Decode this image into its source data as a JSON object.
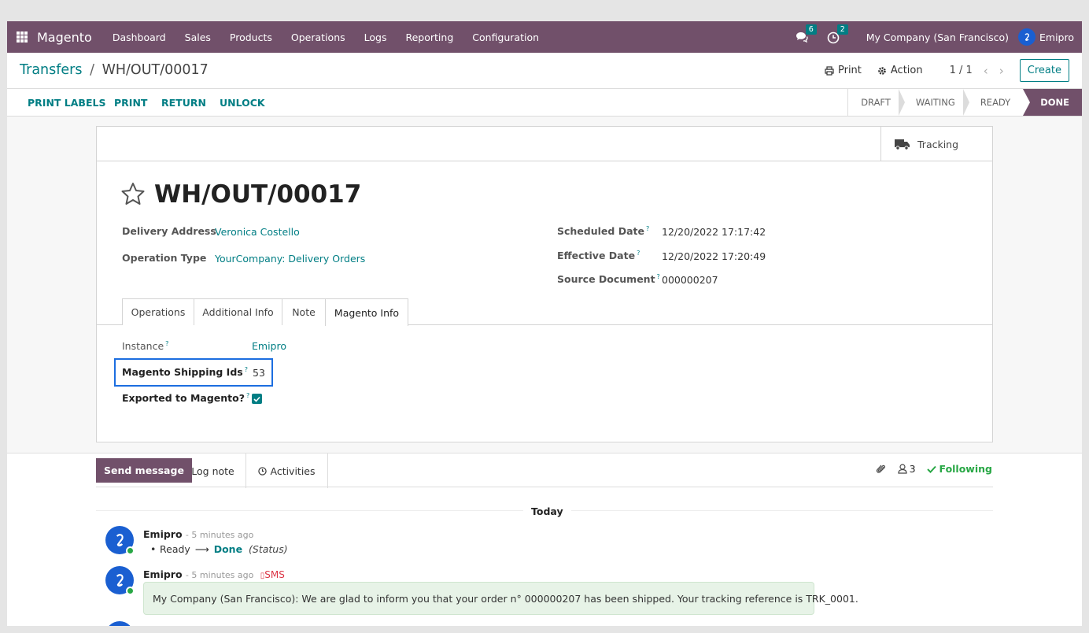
{
  "navbar": {
    "app_name": "Magento",
    "menu": [
      "Dashboard",
      "Sales",
      "Products",
      "Operations",
      "Logs",
      "Reporting",
      "Configuration"
    ],
    "messages_count": "6",
    "activities_count": "2",
    "company": "My Company (San Francisco)",
    "user": "Emipro"
  },
  "control_panel": {
    "breadcrumb_parent": "Transfers",
    "breadcrumb_sep": "/",
    "breadcrumb_current": "WH/OUT/00017",
    "print_label": "Print",
    "action_label": "Action",
    "pager": "1 / 1",
    "create_label": "Create"
  },
  "statusbar": {
    "buttons": [
      "PRINT LABELS",
      "PRINT",
      "RETURN",
      "UNLOCK"
    ],
    "stages": [
      "DRAFT",
      "WAITING",
      "READY",
      "DONE"
    ],
    "current_stage": "DONE"
  },
  "form": {
    "tracking_label": "Tracking",
    "title": "WH/OUT/00017",
    "delivery_address_label": "Delivery Address",
    "delivery_address": "Veronica Costello",
    "operation_type_label": "Operation Type",
    "operation_type": "YourCompany: Delivery Orders",
    "scheduled_date_label": "Scheduled Date",
    "scheduled_date": "12/20/2022 17:17:42",
    "effective_date_label": "Effective Date",
    "effective_date": "12/20/2022 17:20:49",
    "source_document_label": "Source Document",
    "source_document": "000000207",
    "help_mark": "?",
    "tabs": [
      "Operations",
      "Additional Info",
      "Note",
      "Magento Info"
    ],
    "active_tab": "Magento Info",
    "instance_label": "Instance",
    "instance": "Emipro",
    "shipping_ids_label": "Magento Shipping Ids",
    "shipping_ids": "53",
    "exported_label": "Exported to Magento?",
    "exported": true
  },
  "chatter": {
    "send_message": "Send message",
    "log_note": "Log note",
    "activities": "Activities",
    "followers_count": "3",
    "following": "Following",
    "date_separator": "Today",
    "messages": [
      {
        "author": "Emipro",
        "time": "- 5 minutes ago",
        "change_from": "Ready",
        "change_to": "Done",
        "change_field": "(Status)"
      },
      {
        "author": "Emipro",
        "time": "- 5 minutes ago",
        "sms_label": "SMS",
        "body": "My Company (San Francisco): We are glad to inform you that your order n° 000000207 has been shipped. Your tracking reference is TRK_0001."
      }
    ]
  },
  "colors": {
    "brand": "#71506a",
    "link": "#017e84",
    "highlight": "#1c6ee0"
  }
}
